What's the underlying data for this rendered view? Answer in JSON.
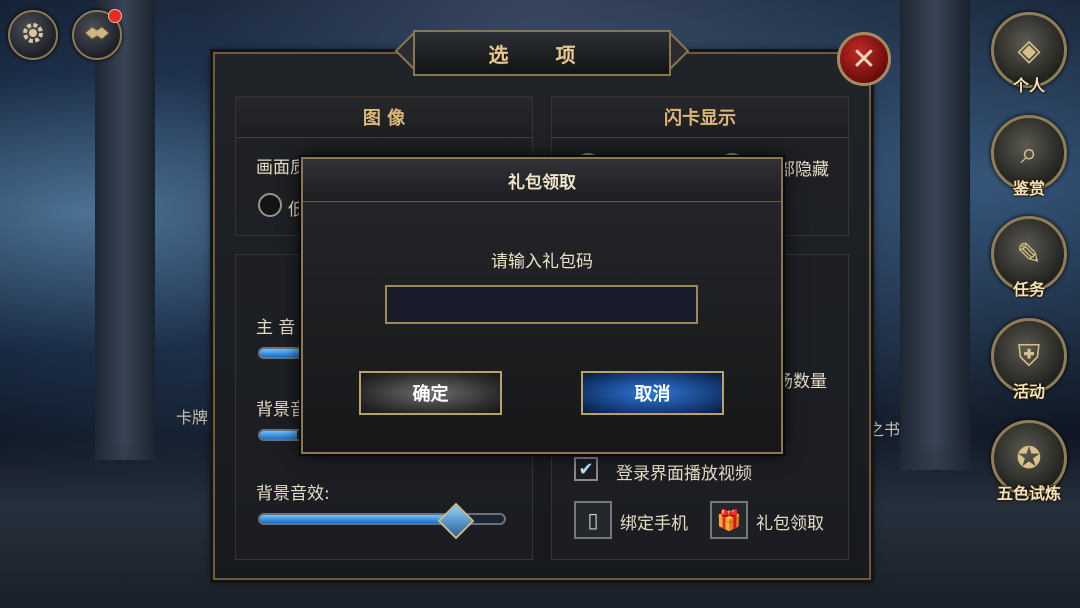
{
  "top_left": {
    "settings_icon": "gear-icon",
    "friends_icon": "handshake-icon"
  },
  "options_panel": {
    "title": "选 项",
    "close_icon": "close-icon",
    "graphics": {
      "title": "图 像",
      "quality_label": "画面质量",
      "quality_option_partial": "低"
    },
    "stage_display": {
      "title": "闪卡显示",
      "option_hide_all": "部隐藏"
    },
    "audio": {
      "main_volume_label": "主 音",
      "bgm_label": "背景音",
      "sfx_label": "背景音效:",
      "main_volume_level": 0.18,
      "bgm_level": 0.15,
      "sfx_level": 0.8
    },
    "other": {
      "count_label_partial": "场数量",
      "play_video_label": "登录界面播放视频",
      "play_video_checked": true,
      "bind_phone_label": "绑定手机",
      "gift_label": "礼包领取"
    },
    "bg_scene_texts": {
      "card_partial": "卡牌",
      "book_partial": "之书"
    }
  },
  "side_menu": [
    {
      "label": "个人",
      "icon": "profile-icon"
    },
    {
      "label": "鉴赏",
      "icon": "magnifier-scroll-icon"
    },
    {
      "label": "任务",
      "icon": "quest-scroll-icon"
    },
    {
      "label": "活动",
      "icon": "armor-icon"
    },
    {
      "label": "五色试炼",
      "icon": "pentagon-gem-icon"
    }
  ],
  "gift_modal": {
    "title": "礼包领取",
    "prompt": "请输入礼包码",
    "input_value": "",
    "confirm_label": "确定",
    "cancel_label": "取消"
  }
}
